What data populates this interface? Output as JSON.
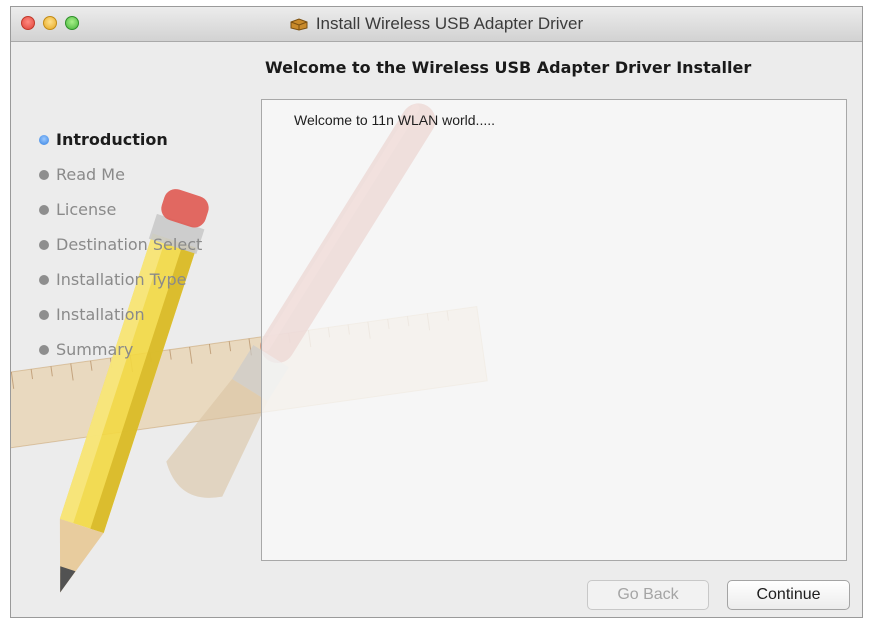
{
  "window": {
    "title": "Install Wireless USB Adapter Driver"
  },
  "titlebar": {
    "close_icon": "close-icon",
    "minimize_icon": "minimize-icon",
    "maximize_icon": "maximize-icon",
    "app_icon": "package-icon"
  },
  "main": {
    "heading": "Welcome to the Wireless USB Adapter Driver Installer",
    "body_text": "Welcome to 11n WLAN world....."
  },
  "sidebar": {
    "steps": [
      {
        "label": "Introduction",
        "active": true
      },
      {
        "label": "Read Me",
        "active": false
      },
      {
        "label": "License",
        "active": false
      },
      {
        "label": "Destination Select",
        "active": false
      },
      {
        "label": "Installation Type",
        "active": false
      },
      {
        "label": "Installation",
        "active": false
      },
      {
        "label": "Summary",
        "active": false
      }
    ]
  },
  "buttons": {
    "go_back": "Go Back",
    "continue": "Continue"
  },
  "colors": {
    "active_step_bullet": "#2f7ee0",
    "inactive_step": "#8a8a8a"
  }
}
